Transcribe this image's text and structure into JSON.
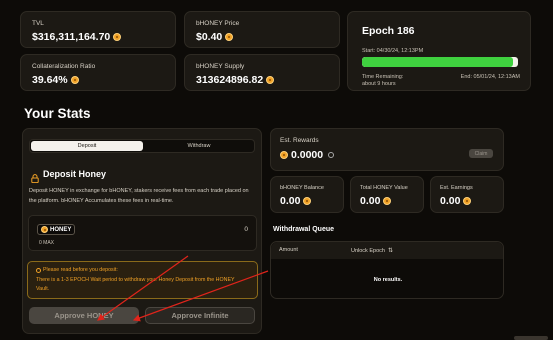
{
  "stats_top": [
    {
      "label": "TVL",
      "value": "$316,311,164.70"
    },
    {
      "label": "bHONEY Price",
      "value": "$0.40"
    },
    {
      "label": "Collateralization Ratio",
      "value": "39.64%"
    },
    {
      "label": "bHONEY Supply",
      "value": "313624896.82"
    }
  ],
  "epoch": {
    "title": "Epoch 186",
    "start": "Start: 04/30/24, 12:13PM",
    "progress": 0.97,
    "remaining_label": "Time Remaining:",
    "remaining_value": "about 9 hours",
    "end": "End: 05/01/24, 12:13AM",
    "bar_color": "#3fd13f"
  },
  "your_stats": {
    "heading": "Your Stats",
    "tabs": [
      "Deposit",
      "Withdraw"
    ],
    "deposit_title": "Deposit Honey",
    "deposit_desc": "Deposit HONEY in exchange for bHONEY, stakers receive fees from each trade placed on the platform. bHONEY Accumulates these fees in real-time.",
    "token_name": "HONEY",
    "token_balance": "0",
    "max_label": "0 MAX",
    "notice_title": "Please read before you deposit:",
    "notice_body": "There is a 1-3 EPOCH Wait period to withdraw your Honey Deposit from the HONEY Vault.",
    "approve_label": "Approve HONEY",
    "approve_infinite_label": "Approve Infinite"
  },
  "rewards": {
    "label": "Est. Rewards",
    "value": "0.0000",
    "claim_label": "Claim"
  },
  "mini_stats": [
    {
      "label": "bHONEY Balance",
      "value": "0.00"
    },
    {
      "label": "Total HONEY Value",
      "value": "0.00"
    },
    {
      "label": "Est. Earnings",
      "value": "0.00"
    }
  ],
  "withdrawal_queue": {
    "title": "Withdrawal Queue",
    "columns": [
      "Amount",
      "Unlock Epoch"
    ],
    "empty_text": "No results."
  },
  "accent": "#f0a126",
  "annotation_color": "#e0241b"
}
